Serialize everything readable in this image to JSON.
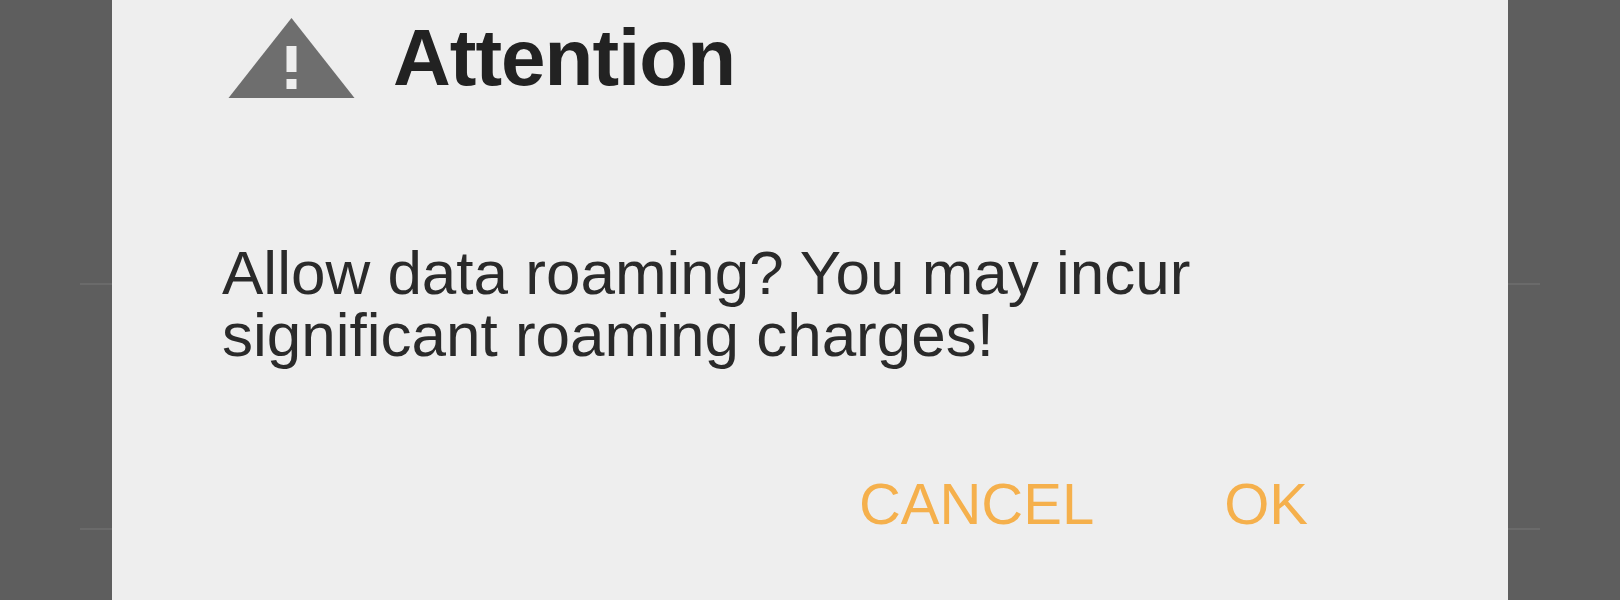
{
  "dialog": {
    "title": "Attention",
    "message": "Allow data roaming? You may incur significant roaming charges!",
    "buttons": [
      {
        "label": "CANCEL"
      },
      {
        "label": "OK"
      }
    ]
  }
}
